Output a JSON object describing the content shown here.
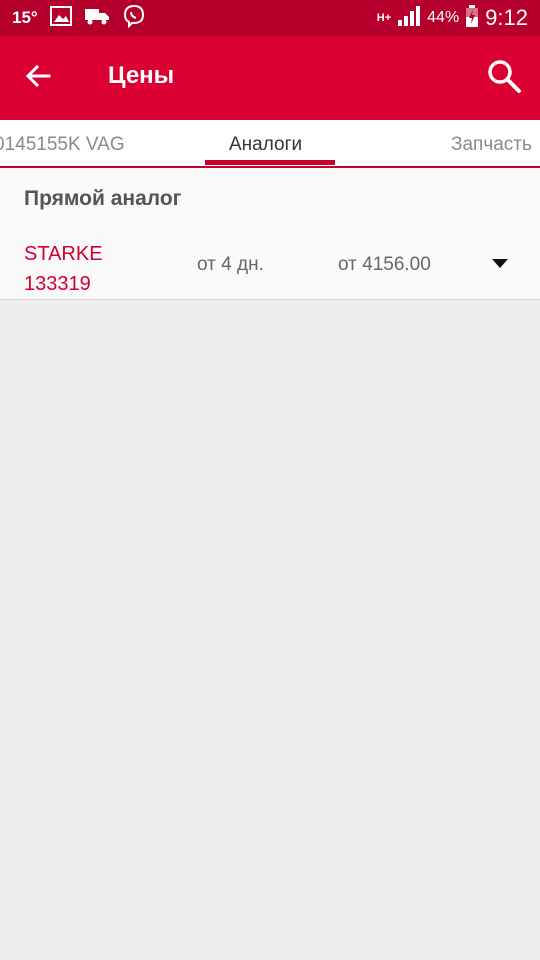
{
  "status_bar": {
    "temperature": "15°",
    "network": "H+",
    "battery": "44%",
    "time": "9:12",
    "icons": [
      "image-icon",
      "truck-icon",
      "viber-icon",
      "signal-icon",
      "battery-icon"
    ]
  },
  "app_bar": {
    "title": "Цены",
    "back_icon": "arrow-left-icon",
    "search_icon": "search-icon",
    "color": "#da0032"
  },
  "tabs": [
    {
      "label": "0145155K VAG"
    },
    {
      "label": "Аналоги",
      "selected": true
    },
    {
      "label": "Запчасть"
    }
  ],
  "section": {
    "heading": "Прямой аналог",
    "items": [
      {
        "brand": "STARKE",
        "code": "133319",
        "delivery": "от 4 дн.",
        "price": "от 4156.00",
        "expand_icon": "caret-down-icon"
      }
    ]
  },
  "colors": {
    "accent": "#da0032",
    "status_bar": "#b5002c",
    "brand_text": "#d2002e",
    "background": "#eeeeee"
  }
}
